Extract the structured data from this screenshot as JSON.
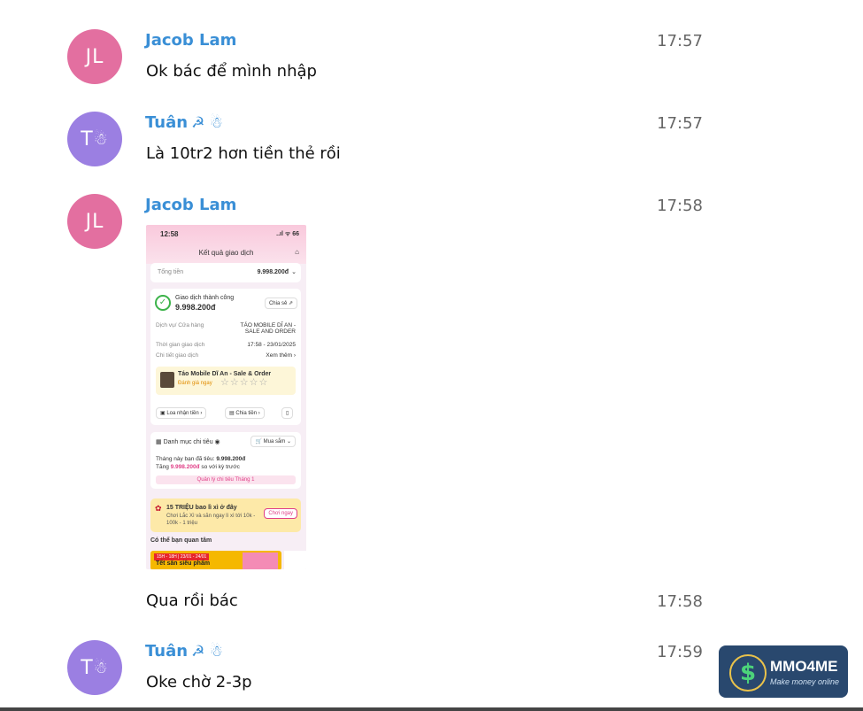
{
  "messages": [
    {
      "initials": "JL",
      "sender": "Jacob Lam",
      "time": "17:57",
      "text": "Ok bác để mình nhập"
    },
    {
      "initials": "T",
      "avatar_emoji": "☃",
      "sender": "Tuân",
      "sender_emoji": "☭ ☃",
      "time": "17:57",
      "text": "Là 10tr2 hơn tiền thẻ rồi"
    },
    {
      "initials": "JL",
      "sender": "Jacob Lam",
      "time": "17:58"
    },
    {
      "time": "17:58",
      "text": "Qua rồi bác"
    },
    {
      "initials": "T",
      "avatar_emoji": "☃",
      "sender": "Tuân",
      "sender_emoji": "☭ ☃",
      "time": "17:59",
      "text": "Oke chờ 2-3p"
    }
  ],
  "attachment": {
    "status_time": "12:58",
    "status_icons": "..ıl ᯤ 66",
    "page_title": "Kết quả giao dịch",
    "total_label": "Tổng tiền",
    "total_value": "9.998.200đ",
    "success_label": "Giao dịch thành công",
    "success_amount": "9.998.200đ",
    "share_label": "Chia sẻ",
    "service_label": "Dịch vụ/ Cửa hàng",
    "service_value_1": "TÁO MOBILE DĨ AN -",
    "service_value_2": "SALE AND ORDER",
    "time_label": "Thời gian giao dịch",
    "time_value": "17:58 - 23/01/2025",
    "detail_label": "Chi tiết giao dịch",
    "detail_link": "Xem thêm",
    "shop_name": "Táo Mobile Dĩ An - Sale & Order",
    "rate_label": "Đánh giá ngay",
    "stars": "☆☆☆☆☆",
    "btn_speaker": "Loa nhận tiền",
    "btn_split": "Chia tiền",
    "category_label": "Danh mục chi tiêu",
    "category_value": "Mua sắm",
    "spent_text": "Tháng này bạn đã tiêu:",
    "spent_value": "9.998.200đ",
    "increase_text": "Tăng",
    "increase_value": "9.998.200đ",
    "increase_suffix": "so với kỳ trước",
    "manage_link": "Quản lý chi tiêu Tháng 1",
    "banner_title": "15 TRIỆU bao lì xì ở đây",
    "banner_sub_1": "Chơi Lắc Xì và săn ngay lì xì tới 10k -",
    "banner_sub_2": "100k - 1 triệu",
    "banner_btn": "Chơi ngay",
    "interest_label": "Có thể bạn quan tâm",
    "promo_date": "15H - 18H | 23/01 - 24/01",
    "promo_title": "Tết săn siêu phẩm"
  },
  "logo": {
    "brand": "MMO4ME",
    "tagline": "Make money online",
    "symbol": "$"
  }
}
